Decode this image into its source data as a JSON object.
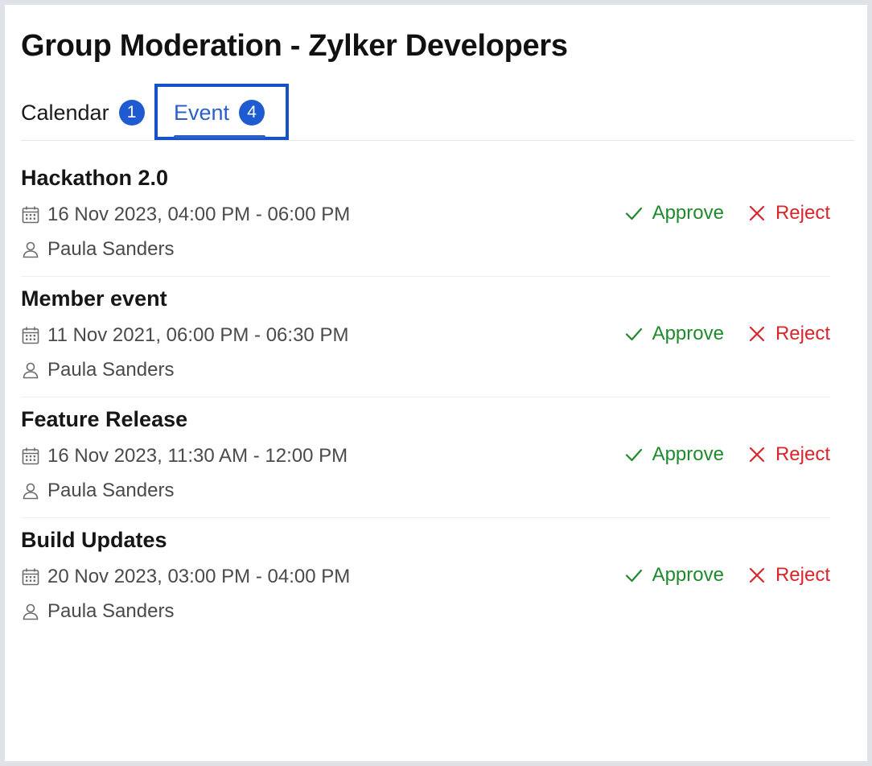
{
  "header": {
    "title": "Group Moderation - Zylker Developers"
  },
  "tabs": [
    {
      "label": "Calendar",
      "count": "1",
      "selected": false
    },
    {
      "label": "Event",
      "count": "4",
      "selected": true
    }
  ],
  "actions": {
    "approve_label": "Approve",
    "reject_label": "Reject"
  },
  "icons": {
    "date": "calendar-icon",
    "user": "user-icon",
    "approve": "check-icon",
    "reject": "close-icon"
  },
  "colors": {
    "accent": "#1f5bd0",
    "approve": "#1f8a2c",
    "reject": "#d9252b"
  },
  "events": [
    {
      "title": "Hackathon 2.0",
      "datetime": "16 Nov 2023, 04:00 PM - 06:00 PM",
      "user": "Paula Sanders"
    },
    {
      "title": "Member event",
      "datetime": "11 Nov 2021, 06:00 PM - 06:30 PM",
      "user": "Paula Sanders"
    },
    {
      "title": "Feature Release",
      "datetime": "16 Nov 2023, 11:30 AM - 12:00 PM",
      "user": "Paula Sanders"
    },
    {
      "title": "Build Updates",
      "datetime": "20 Nov 2023, 03:00 PM - 04:00 PM",
      "user": "Paula Sanders"
    }
  ]
}
